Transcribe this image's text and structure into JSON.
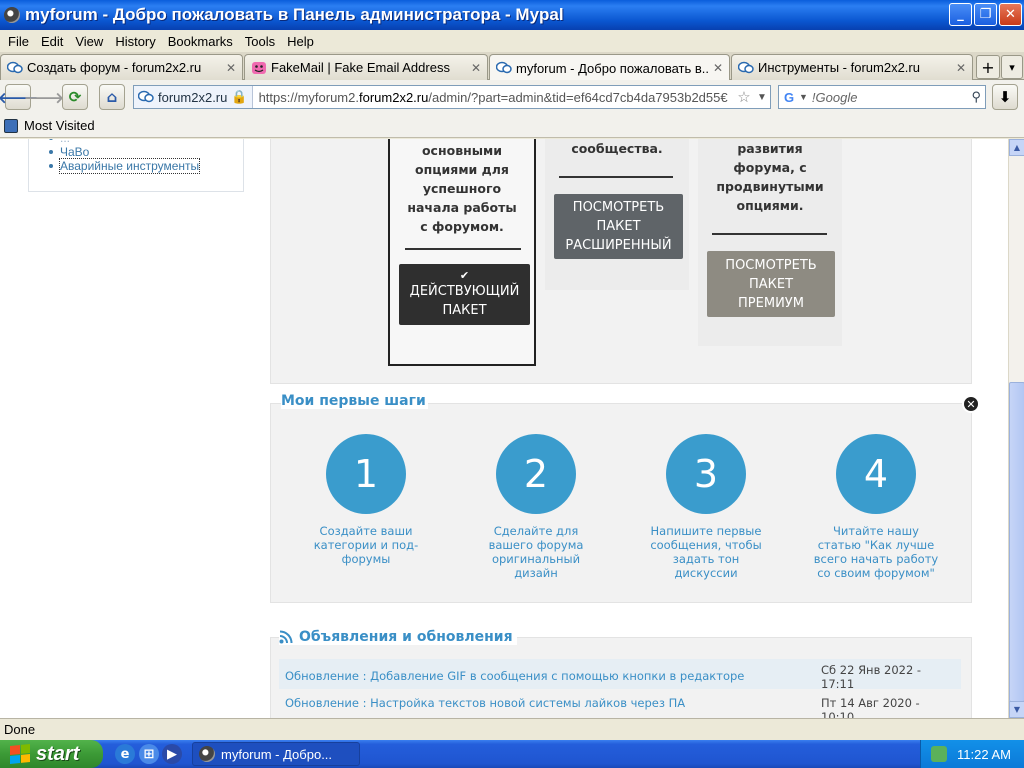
{
  "window": {
    "title": "myforum - Добро пожаловать в Панель администратора - Mypal"
  },
  "menu": [
    "File",
    "Edit",
    "View",
    "History",
    "Bookmarks",
    "Tools",
    "Help"
  ],
  "tabs": [
    {
      "label": "Создать форум - forum2x2.ru",
      "active": false
    },
    {
      "label": "FakeMail | Fake Email Address",
      "active": false
    },
    {
      "label": "myforum - Добро пожаловать в...",
      "active": true
    },
    {
      "label": "Инструменты - forum2x2.ru",
      "active": false
    }
  ],
  "nav": {
    "identity": "forum2x2.ru",
    "url_prefix": "https://myforum2.",
    "url_domain": "forum2x2.ru",
    "url_suffix": "/admin/?part=admin&tid=ef64cd7cb4da7953b2d55€",
    "search_placeholder": "!Google"
  },
  "bookmarks": {
    "most_visited": "Most Visited"
  },
  "sidebar": {
    "items": [
      {
        "label": "...",
        "state": "dim"
      },
      {
        "label": "ЧаВо",
        "state": "normal"
      },
      {
        "label": "Аварийные инструменты",
        "state": "selected"
      }
    ]
  },
  "plans": {
    "basic_desc": "пакет с основными опциями для успешного начала работы с форумом.",
    "basic_btn_icon": "✔",
    "basic_btn": "ДЕЙСТВУЮЩИЙ ПАКЕТ",
    "adv_desc": "форума и его сообщества.",
    "adv_btn": "ПОСМОТРЕТЬ ПАКЕТ РАСШИРЕННЫЙ",
    "prem_desc": "ускорения развития форума, с продвинутыми опциями.",
    "prem_btn": "ПОСМОТРЕТЬ ПАКЕТ ПРЕМИУМ"
  },
  "steps": {
    "title": "Мои первые шаги",
    "items": [
      {
        "number": "1",
        "text": "Создайте ваши категории и под-форумы"
      },
      {
        "number": "2",
        "text": "Сделайте для вашего форума оригинальный дизайн"
      },
      {
        "number": "3",
        "text": "Напишите первые сообщения, чтобы задать тон дискуссии"
      },
      {
        "number": "4",
        "text": "Читайте нашу статью \"Как лучше всего начать работу со своим форумом\""
      }
    ]
  },
  "news": {
    "title": "Объявления и обновления",
    "rows": [
      {
        "title": "Обновление : Добавление GIF в сообщения с помощью кнопки в редакторе",
        "date": "Сб 22 Янв 2022 - 17:11"
      },
      {
        "title": "Обновление : Настройка текстов новой системы лайков через ПА",
        "date": "Пт 14 Авг 2020 - 10:10"
      }
    ]
  },
  "status": {
    "text": "Done"
  },
  "taskbar": {
    "start": "start",
    "task": "myforum - Добро...",
    "clock": "11:22 AM"
  },
  "colors": {
    "accent": "#3a9ccd",
    "link": "#3a8fc6",
    "titlebar": "#0a5ddb"
  }
}
